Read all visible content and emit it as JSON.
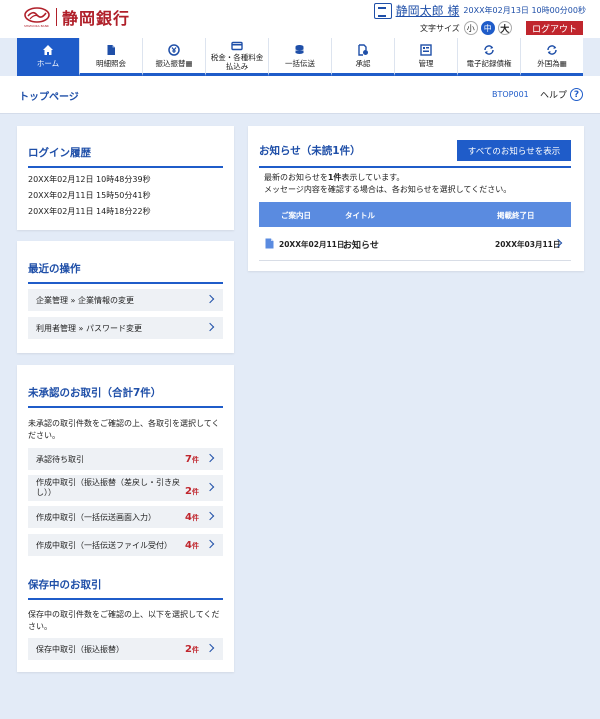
{
  "header": {
    "bank_name": "静岡銀行",
    "logo_sub": "SHIZUOKA BANK",
    "user_name": "静岡太郎 様",
    "datetime": "20XX年02月13日 10時00分00秒",
    "font_size_label": "文字サイズ",
    "font_sizes": [
      "小",
      "中",
      "大"
    ],
    "logout_label": "ログアウト"
  },
  "nav": {
    "items": [
      {
        "label": "ホーム",
        "icon": "home-icon"
      },
      {
        "label": "明細照会",
        "icon": "document-icon"
      },
      {
        "label": "振込振替▦",
        "icon": "transfer-icon"
      },
      {
        "label": "税金・各種料金",
        "label2": "払込み",
        "icon": "payment-icon"
      },
      {
        "label": "一括伝送",
        "icon": "database-icon"
      },
      {
        "label": "承認",
        "icon": "approval-icon"
      },
      {
        "label": "管理",
        "icon": "admin-icon"
      },
      {
        "label": "電子記録債権",
        "icon": "cycle-icon"
      },
      {
        "label": "外国為▦",
        "icon": "cycle-icon"
      }
    ]
  },
  "page": {
    "title": "トップページ",
    "id": "BTOP001",
    "help_label": "ヘルプ",
    "help_icon_text": "?"
  },
  "login_history": {
    "title": "ログイン履歴",
    "entries": [
      "20XX年02月12日 10時48分39秒",
      "20XX年02月11日 15時50分41秒",
      "20XX年02月11日 14時18分22秒"
    ]
  },
  "recent_ops": {
    "title": "最近の操作",
    "items": [
      "企業管理 » 企業情報の変更",
      "利用者管理 » パスワード変更"
    ]
  },
  "unapproved": {
    "title": "未承認のお取引（合計7件）",
    "description": "未承認の取引件数をご確認の上、各取引を選択してください。",
    "count_unit": "件",
    "items": [
      {
        "label": "承認待ち取引",
        "count": "7"
      },
      {
        "label": "作成中取引（振込振替（差戻し・引き戻し））",
        "count": "2"
      },
      {
        "label": "作成中取引（一括伝送画面入力）",
        "count": "4"
      },
      {
        "label": "作成中取引（一括伝送ファイル受付）",
        "count": "4"
      }
    ]
  },
  "saved": {
    "title": "保存中のお取引",
    "description": "保存中の取引件数をご確認の上、以下を選択してください。",
    "items": [
      {
        "label": "保存中取引（振込振替）",
        "count": "2"
      }
    ]
  },
  "notices": {
    "title": "お知らせ（未読1件）",
    "show_all_label": "すべてのお知らせを表示",
    "desc_line1_pre": "最新のお知らせを",
    "desc_line1_bold": "1件",
    "desc_line1_post": "表示しています。",
    "desc_line2": "メッセージ内容を確認する場合は、各お知らせを選択してください。",
    "columns": [
      "ご案内日",
      "タイトル",
      "掲載終了日"
    ],
    "rows": [
      {
        "date": "20XX年02月11日",
        "title": "お知らせ",
        "end_date": "20XX年03月11日"
      }
    ]
  }
}
